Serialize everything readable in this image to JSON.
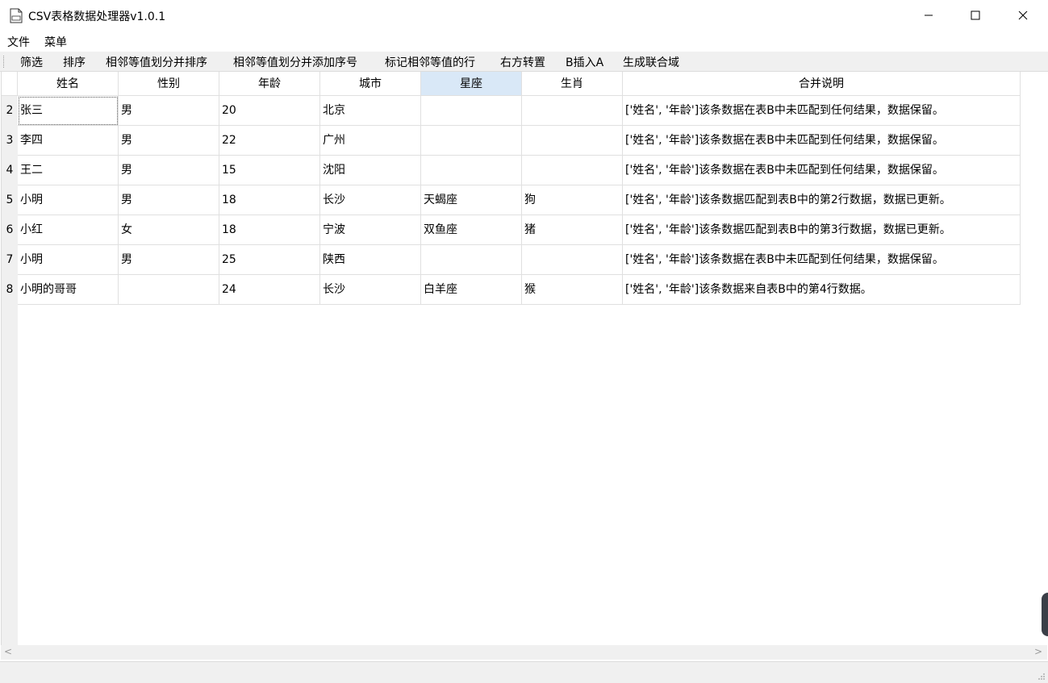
{
  "window": {
    "title": "CSV表格数据处理器v1.0.1",
    "controls": {
      "minimize": "—",
      "maximize": "☐",
      "close": "✕"
    }
  },
  "menubar": {
    "items": [
      "文件",
      "菜单"
    ]
  },
  "toolbar": {
    "items": [
      "筛选",
      "排序",
      "相邻等值划分并排序",
      "相邻等值划分并添加序号",
      "标记相邻等值的行",
      "右方转置",
      "B插入A",
      "生成联合域"
    ]
  },
  "table": {
    "columns": [
      "姓名",
      "性别",
      "年龄",
      "城市",
      "星座",
      "生肖",
      "合并说明"
    ],
    "selected_column": "星座",
    "rows": [
      {
        "num": "2",
        "cells": [
          "张三",
          "男",
          "20",
          "北京",
          "",
          "",
          "['姓名', '年龄']该条数据在表B中未匹配到任何结果，数据保留。"
        ]
      },
      {
        "num": "3",
        "cells": [
          "李四",
          "男",
          "22",
          "广州",
          "",
          "",
          "['姓名', '年龄']该条数据在表B中未匹配到任何结果，数据保留。"
        ]
      },
      {
        "num": "4",
        "cells": [
          "王二",
          "男",
          "15",
          "沈阳",
          "",
          "",
          "['姓名', '年龄']该条数据在表B中未匹配到任何结果，数据保留。"
        ]
      },
      {
        "num": "5",
        "cells": [
          "小明",
          "男",
          "18",
          "长沙",
          "天蝎座",
          "狗",
          "['姓名', '年龄']该条数据匹配到表B中的第2行数据，数据已更新。"
        ]
      },
      {
        "num": "6",
        "cells": [
          "小红",
          "女",
          "18",
          "宁波",
          "双鱼座",
          "猪",
          "['姓名', '年龄']该条数据匹配到表B中的第3行数据，数据已更新。"
        ]
      },
      {
        "num": "7",
        "cells": [
          "小明",
          "男",
          "25",
          "陕西",
          "",
          "",
          "['姓名', '年龄']该条数据在表B中未匹配到任何结果，数据保留。"
        ]
      },
      {
        "num": "8",
        "cells": [
          "小明的哥哥",
          "",
          "24",
          "长沙",
          "白羊座",
          "猴",
          "['姓名', '年龄']该条数据来自表B中的第4行数据。"
        ]
      }
    ]
  },
  "scrollbar": {
    "left_arrow": "<",
    "right_arrow": ">"
  }
}
